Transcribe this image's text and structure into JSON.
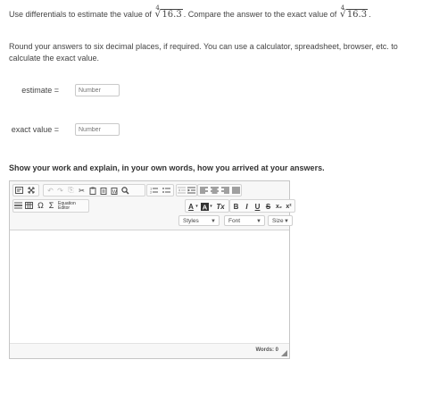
{
  "question": {
    "part1": "Use differentials to estimate the value of ",
    "radical_index": "4",
    "radicand": "16.3",
    "part2": ". Compare the answer to the exact value of ",
    "end": ".",
    "instructions": "Round your answers to six decimal places, if required. You can use a calculator, spreadsheet, browser, etc. to calculate the exact value."
  },
  "fields": {
    "estimate_label": "estimate =",
    "exact_label": "exact value =",
    "placeholder": "Number"
  },
  "prompt": "Show your work and explain, in your own words, how you arrived at your answers.",
  "editor": {
    "equation_editor": "Equation Editor",
    "styles": "Styles",
    "font": "Font",
    "size": "Size",
    "bold": "B",
    "italic": "I",
    "underline": "U",
    "strike": "S",
    "subscript": "x₂",
    "superscript": "x²",
    "font_color": "A",
    "bg_color": "A",
    "remove_format": "Tx",
    "omega": "Ω",
    "sigma": "Σ",
    "words": "Words: 0"
  }
}
